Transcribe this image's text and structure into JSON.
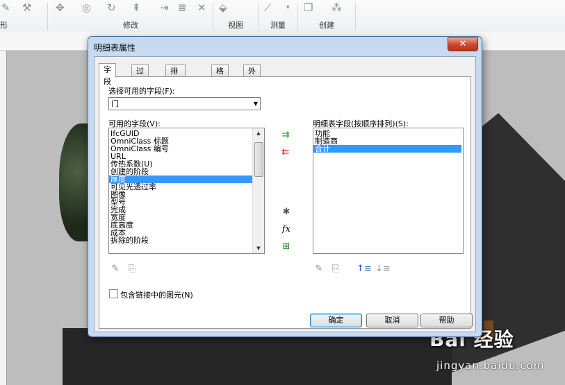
{
  "ribbon": {
    "groups": [
      {
        "label": "形"
      },
      {
        "label": "修改"
      },
      {
        "label": "视图"
      },
      {
        "label": "测量"
      },
      {
        "label": "创建"
      }
    ]
  },
  "dialog": {
    "title": "明细表属性",
    "close_label": "✕",
    "tabs": [
      {
        "label": "字段",
        "active": true
      },
      {
        "label": "过滤器"
      },
      {
        "label": "排序/成组"
      },
      {
        "label": "格式"
      },
      {
        "label": "外观"
      }
    ],
    "select_field_label": "选择可用的字段(F):",
    "select_field_value": "门",
    "available_label": "可用的字段(V):",
    "available_fields": [
      "IfcGUID",
      "OmniClass 标题",
      "OmniClass 编号",
      "URL",
      "传热系数(U)",
      "创建的阶段",
      "厚度",
      "可见光透过率",
      "图像",
      "型号",
      "完成",
      "宽度",
      "底高度",
      "成本",
      "拆除的阶段"
    ],
    "available_selected_index": 6,
    "schedule_label": "明细表字段(按顺序排列)(S):",
    "schedule_fields": [
      "功能",
      "制造商",
      "合计"
    ],
    "schedule_selected_index": 2,
    "include_links_label": "包含链接中的图元(N)",
    "include_links_checked": false,
    "buttons": {
      "ok": "确定",
      "cancel": "取消",
      "help": "帮助"
    }
  },
  "watermark": {
    "brand": "Bai 经验",
    "url": "jingyan.baidu.com"
  }
}
